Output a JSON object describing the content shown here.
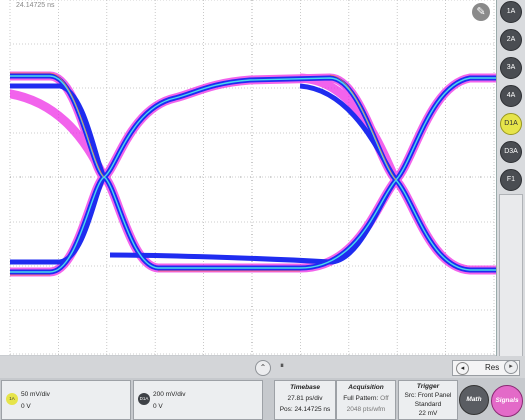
{
  "scope": {
    "timestamp": "24.14725 ns",
    "wrench_icon": "wrench-icon"
  },
  "right_sidebar": {
    "channels": [
      "1A",
      "2A",
      "3A",
      "4A",
      "D1A",
      "D3A",
      "F1"
    ],
    "active_channel": "D1A"
  },
  "bottom_controls": {
    "handle_glyph": "⏸",
    "result_label": "Res"
  },
  "status": {
    "ch1": {
      "chip": "1A",
      "scale": "50 mV/div",
      "offset": "0 V"
    },
    "d1": {
      "chip": "D1A",
      "scale": "200 mV/div",
      "offset": "0 V"
    },
    "timebase": {
      "title": "Timebase",
      "line1": "27.81 ps/div",
      "line2": "Pos: 24.14725 ns"
    },
    "acquisition": {
      "title": "Acquisition",
      "line1_a": "Full Pattern:",
      "line1_b": "Off",
      "line2": "2048 pts/wfm"
    },
    "trigger": {
      "title": "Trigger",
      "line1": "Src: Front Panel",
      "line2": "Standard",
      "line3": "22 mV"
    },
    "math_label": "Math",
    "signals_label": "Signals"
  },
  "colors": {
    "accent_yellow": "#e6e44a",
    "signals_pink": "#e36ac8",
    "eye_blue": "#1f2cf0",
    "eye_magenta": "#ee2fe6"
  }
}
